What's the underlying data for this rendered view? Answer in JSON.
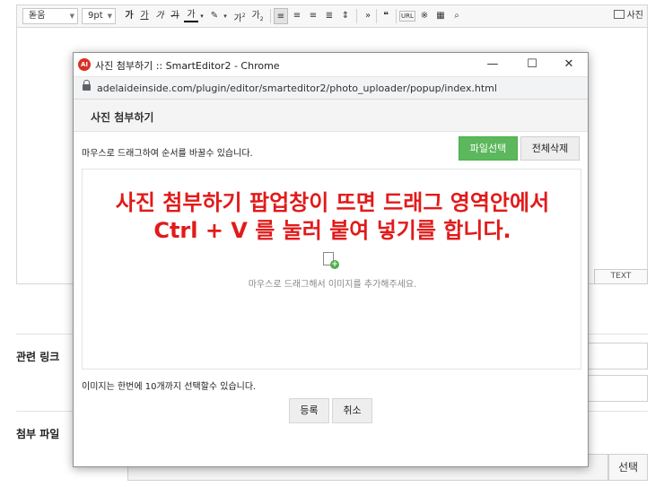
{
  "toolbar": {
    "font": "돋움",
    "size": "9pt",
    "bold": "가",
    "underline": "가",
    "italic": "가",
    "strike": "가",
    "font_color": "가",
    "superscript": "가",
    "subscript": "가",
    "more": "»",
    "quote": "❝",
    "url": "URL",
    "special_char": "※",
    "photo_label": "사진"
  },
  "editor": {
    "text_mode": "TEXT"
  },
  "form": {
    "related_link_label": "관련 링크",
    "attach_file_label": "첨부 파일",
    "choose_button": "선택"
  },
  "window": {
    "title": "사진 첨부하기 :: SmartEditor2 - Chrome",
    "app_icon_text": "AI",
    "minimize": "—",
    "maximize": "☐",
    "close": "✕",
    "url": "adelaideinside.com/plugin/editor/smarteditor2/photo_uploader/popup/index.html"
  },
  "popup": {
    "title": "사진 첨부하기",
    "drag_hint": "마우스로 드래그하여 순서를 바꿀수 있습니다.",
    "select_file_button": "파일선택",
    "delete_all_button": "전체삭제",
    "annotation_line1": "사진 첨부하기 팝업창이 뜨면 드래그 영역안에서",
    "annotation_line2": "Ctrl + V 를 눌러 붙여 넣기를 합니다.",
    "drop_text": "마우스로 드래그해서 이미지를 추가해주세요.",
    "limit_text": "이미지는 한번에 10개까지 선택할수 있습니다.",
    "register_button": "등록",
    "cancel_button": "취소"
  },
  "colors": {
    "annotation": "#e21a1a",
    "select_button": "#5cb85c",
    "chrome_icon": "#d93025"
  }
}
